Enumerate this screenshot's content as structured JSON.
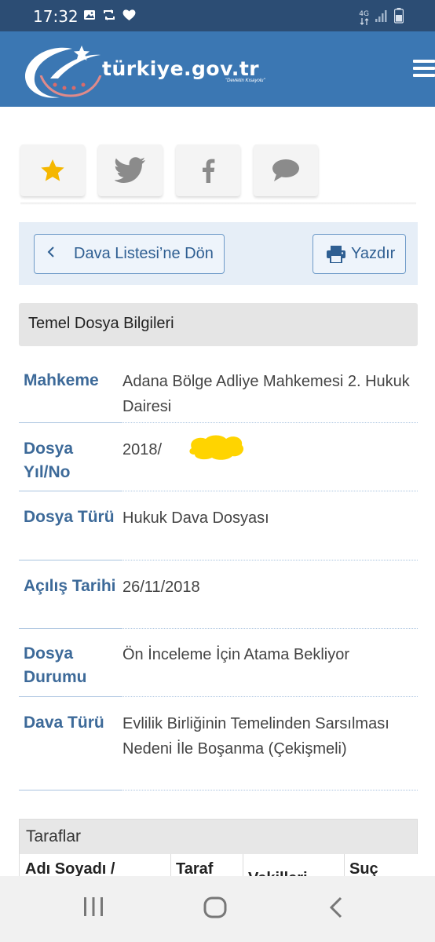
{
  "status_bar": {
    "time": "17:32",
    "network": "4G",
    "icons_left": [
      "image-icon",
      "sync-icon",
      "heart-icon"
    ],
    "icons_right": [
      "network-4g-icon",
      "signal-icon",
      "battery-icon"
    ]
  },
  "header": {
    "brand": "türkiye.gov.tr",
    "tagline": "\"Devletin Kısayolu\"",
    "menu_icon": "hamburger-menu-icon"
  },
  "share_buttons": [
    {
      "icon": "star-icon"
    },
    {
      "icon": "twitter-icon"
    },
    {
      "icon": "facebook-icon"
    },
    {
      "icon": "comment-icon"
    }
  ],
  "actions": {
    "back_label": "Dava Listesi’ne Dön",
    "print_label": "Yazdır"
  },
  "section_title": "Temel Dosya Bilgileri",
  "details": [
    {
      "label": "Mahkeme",
      "value": "Adana Bölge Adliye Mahkemesi 2. Hukuk Dairesi"
    },
    {
      "label": "Dosya Yıl/No",
      "value": "2018/"
    },
    {
      "label": "Dosya Türü",
      "value": "Hukuk Dava Dosyası"
    },
    {
      "label": "Açılış Tarihi",
      "value": "26/11/2018"
    },
    {
      "label": "Dosya Durumu",
      "value": "Ön İnceleme İçin Atama Bekliyor"
    },
    {
      "label": "Dava Türü",
      "value": "Evlilik Birliğinin Temelinden Sarsılması Nedeni İle Boşanma (Çekişmeli)"
    }
  ],
  "parties": {
    "title": "Taraflar",
    "columns": [
      "Adı Soyadı /",
      "Taraf",
      "Vekilleri",
      "Suç"
    ]
  },
  "colors": {
    "status_bar": "#2c4d74",
    "header": "#3b77b3",
    "label_blue": "#3d6a99",
    "star_gold": "#f5b700",
    "redaction_yellow": "#ffd400"
  }
}
